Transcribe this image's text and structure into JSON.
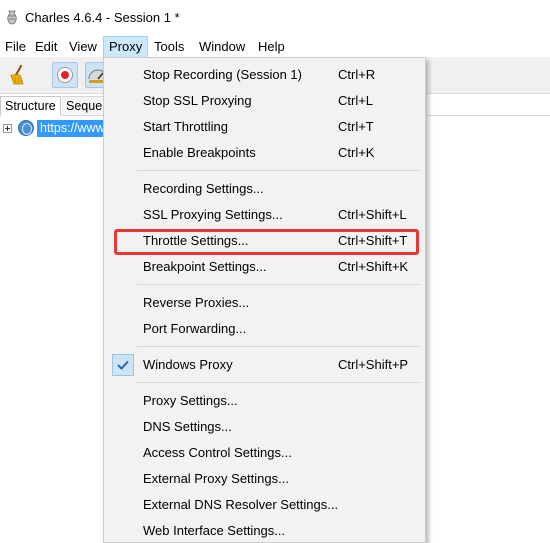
{
  "window": {
    "title": "Charles 4.6.4 - Session 1 *"
  },
  "menubar": {
    "items": [
      {
        "label": "File"
      },
      {
        "label": "Edit"
      },
      {
        "label": "View"
      },
      {
        "label": "Proxy",
        "active": true
      },
      {
        "label": "Tools"
      },
      {
        "label": "Window"
      },
      {
        "label": "Help"
      }
    ]
  },
  "toolbar": {
    "buttons": [
      "broom-icon",
      "record-icon",
      "throttle-icon"
    ]
  },
  "tabs": {
    "structure": "Structure",
    "sequence": "Seque"
  },
  "tree": {
    "host": "https://www"
  },
  "proxy_menu": {
    "items": [
      {
        "label": "Stop Recording (Session 1)",
        "shortcut": "Ctrl+R"
      },
      {
        "label": "Stop SSL Proxying",
        "shortcut": "Ctrl+L"
      },
      {
        "label": "Start Throttling",
        "shortcut": "Ctrl+T"
      },
      {
        "label": "Enable Breakpoints",
        "shortcut": "Ctrl+K"
      },
      {
        "label": "Recording Settings...",
        "shortcut": ""
      },
      {
        "label": "SSL Proxying Settings...",
        "shortcut": "Ctrl+Shift+L"
      },
      {
        "label": "Throttle Settings...",
        "shortcut": "Ctrl+Shift+T"
      },
      {
        "label": "Breakpoint Settings...",
        "shortcut": "Ctrl+Shift+K"
      },
      {
        "label": "Reverse Proxies...",
        "shortcut": ""
      },
      {
        "label": "Port Forwarding...",
        "shortcut": ""
      },
      {
        "label": "Windows Proxy",
        "shortcut": "Ctrl+Shift+P",
        "checked": true
      },
      {
        "label": "Proxy Settings...",
        "shortcut": ""
      },
      {
        "label": "DNS Settings...",
        "shortcut": ""
      },
      {
        "label": "Access Control Settings...",
        "shortcut": ""
      },
      {
        "label": "External Proxy Settings...",
        "shortcut": ""
      },
      {
        "label": "External DNS Resolver Settings...",
        "shortcut": ""
      },
      {
        "label": "Web Interface Settings...",
        "shortcut": ""
      }
    ]
  },
  "colors": {
    "highlight_border": "#e53935",
    "selection": "#3399ff",
    "menu_active": "#cce8ff",
    "record_dot": "#e8202a"
  }
}
